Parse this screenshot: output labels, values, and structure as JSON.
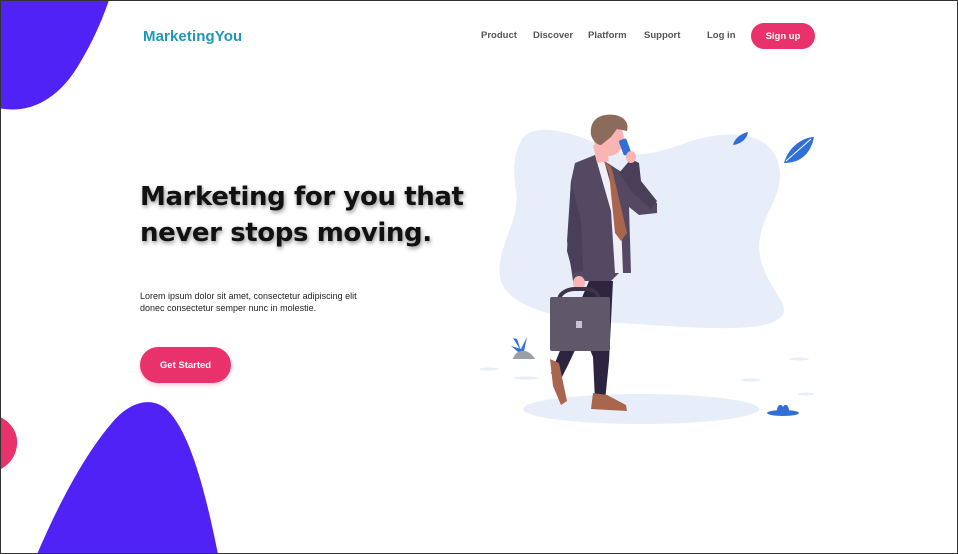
{
  "brand": {
    "name": "MarketingYou",
    "color": "#1d97b8"
  },
  "nav": {
    "items": [
      {
        "label": "Product"
      },
      {
        "label": "Discover"
      },
      {
        "label": "Platform"
      },
      {
        "label": "Support"
      }
    ],
    "login_label": "Log in",
    "signup_label": "Sign up"
  },
  "hero": {
    "headline_line1": "Marketing for you that",
    "headline_line2": "never stops moving.",
    "description_line1": "Lorem ipsum dolor sit amet, consectetur adipiscing elit",
    "description_line2": "donec consectetur semper nunc in molestie.",
    "cta_label": "Get Started"
  },
  "colors": {
    "accent": "#e9316b",
    "blob": "#5122f5",
    "illustration_bg": "#e7eef9"
  },
  "illustration": {
    "icon": "businessman-walking-phone-icon"
  }
}
